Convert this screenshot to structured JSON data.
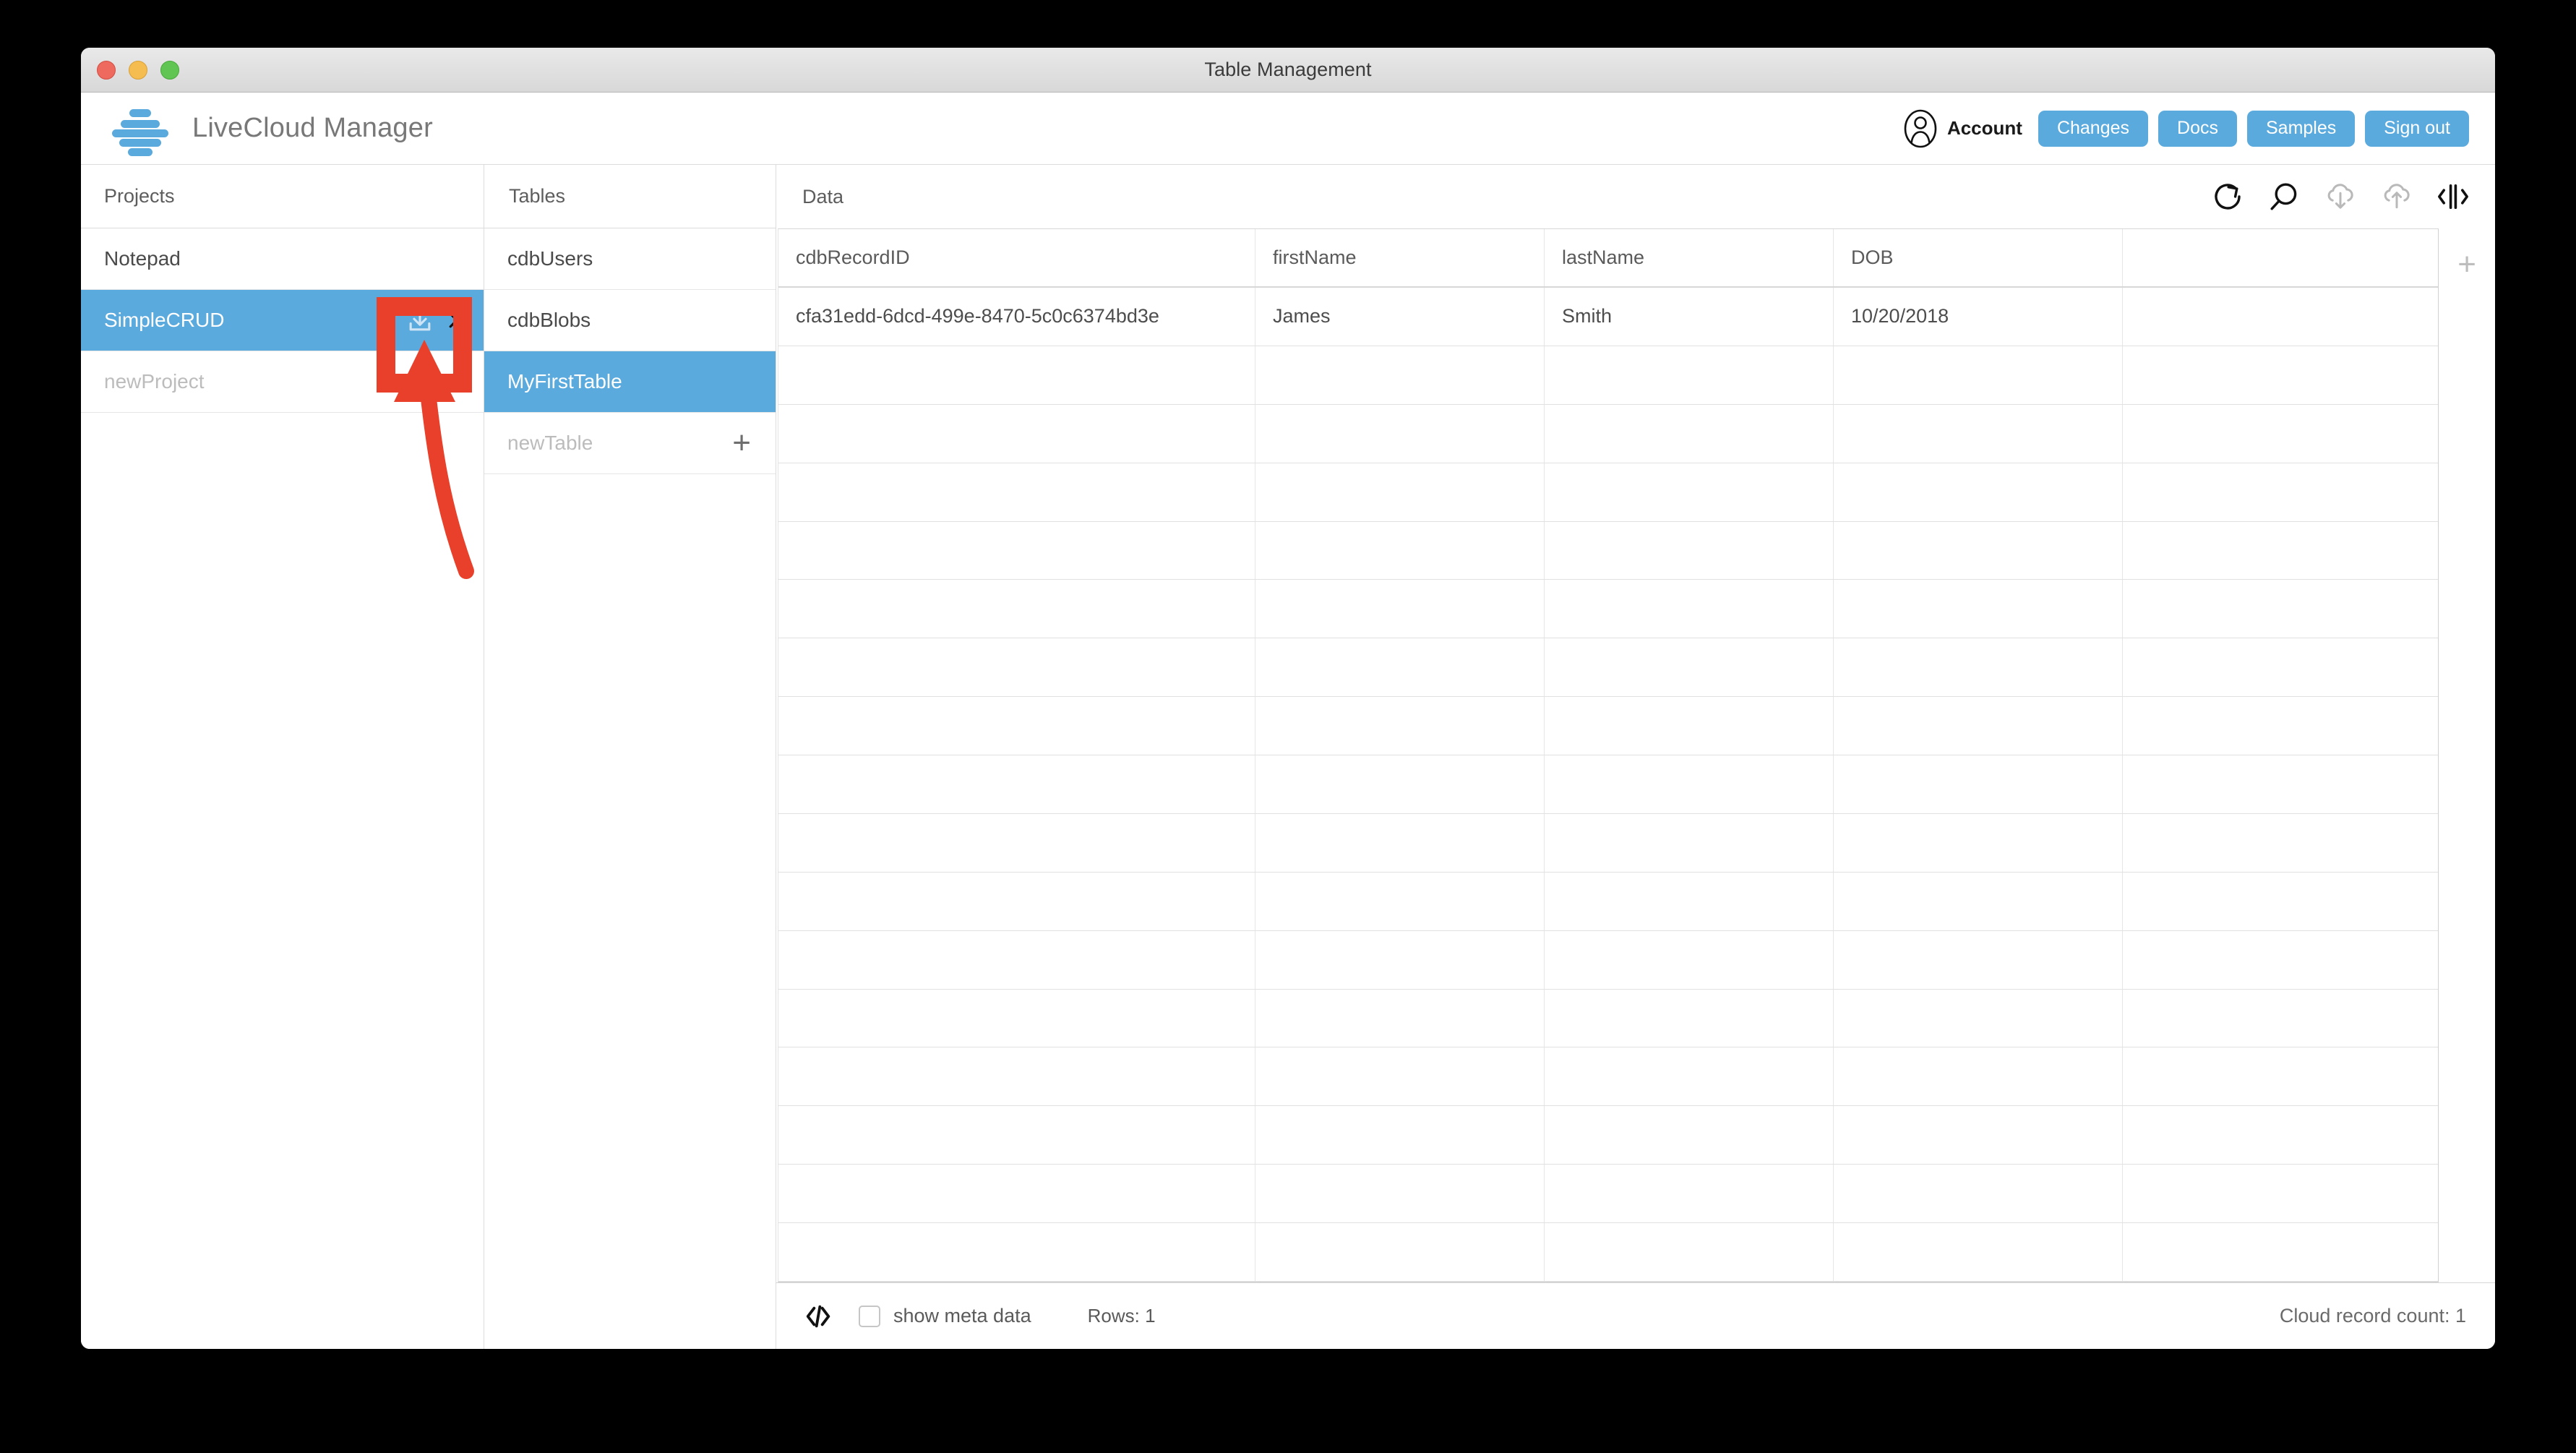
{
  "window": {
    "title": "Table Management",
    "traffic_lights": [
      "close",
      "minimize",
      "zoom"
    ]
  },
  "header": {
    "brand_name": "LiveCloud Manager",
    "logo_icon": "livecloud-stack-logo",
    "account_icon": "account-person-icon",
    "account_label": "Account",
    "buttons": [
      {
        "label": "Changes",
        "name": "changes-button"
      },
      {
        "label": "Docs",
        "name": "docs-button"
      },
      {
        "label": "Samples",
        "name": "samples-button"
      },
      {
        "label": "Sign out",
        "name": "sign-out-button"
      }
    ]
  },
  "projects": {
    "title": "Projects",
    "items": [
      {
        "label": "Notepad",
        "selected": false
      },
      {
        "label": "SimpleCRUD",
        "selected": true
      }
    ],
    "new_placeholder": "newProject",
    "add_label": "+",
    "download_icon": "download-icon",
    "close_icon": "close-x-icon"
  },
  "tables": {
    "title": "Tables",
    "items": [
      {
        "label": "cdbUsers",
        "selected": false
      },
      {
        "label": "cdbBlobs",
        "selected": false
      },
      {
        "label": "MyFirstTable",
        "selected": true
      }
    ],
    "new_placeholder": "newTable",
    "add_label": "+"
  },
  "data": {
    "title": "Data",
    "tools": [
      {
        "name": "refresh-icon",
        "enabled": true
      },
      {
        "name": "search-icon",
        "enabled": true
      },
      {
        "name": "cloud-download-icon",
        "enabled": false
      },
      {
        "name": "cloud-upload-icon",
        "enabled": false
      },
      {
        "name": "split-view-icon",
        "enabled": true
      }
    ],
    "columns": [
      "cdbRecordID",
      "firstName",
      "lastName",
      "DOB",
      ""
    ],
    "rows": [
      [
        "cfa31edd-6dcd-499e-8470-5c0c6374bd3e",
        "James",
        "Smith",
        "10/20/2018",
        ""
      ]
    ],
    "empty_row_count": 16,
    "add_column_label": "+"
  },
  "status": {
    "code_icon": "code-brackets-icon",
    "show_meta_data_label": "show meta data",
    "show_meta_data_checked": false,
    "rows_label": "Rows: 1",
    "cloud_record_count": "Cloud record count: 1"
  },
  "annotation": {
    "highlight_target": "project-download-icon",
    "box_color": "#e8402a",
    "arrow_color": "#e8402a"
  },
  "colors": {
    "accent": "#5aaade",
    "annotation": "#e8402a",
    "text": "#4a4a4a"
  }
}
